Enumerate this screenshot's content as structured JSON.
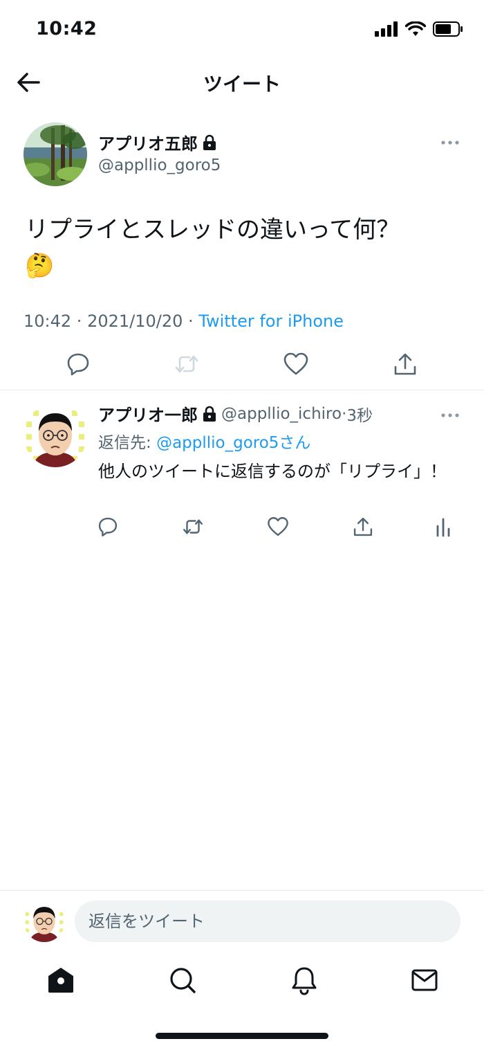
{
  "status_bar": {
    "time": "10:42"
  },
  "nav": {
    "title": "ツイート"
  },
  "main_tweet": {
    "author_name": "アプリオ五郎",
    "author_handle": "@appllio_goro5",
    "text": "リプライとスレッドの違いって何？",
    "emoji": "🤔",
    "time": "10:42",
    "date": "2021/10/20",
    "separator": " · ",
    "source": "Twitter for iPhone"
  },
  "reply": {
    "author_name": "アプリオ一郎",
    "author_handle": "@appllio_ichiro",
    "time_sep": " · ",
    "time_ago": "3秒",
    "reply_to_prefix": "返信先: ",
    "reply_to_mention": "@appllio_goro5さん",
    "text": "他人のツイートに返信するのが「リプライ」！"
  },
  "compose": {
    "placeholder": "返信をツイート"
  },
  "colors": {
    "accent": "#1d9bf0",
    "muted": "#536471",
    "text": "#0f1419"
  },
  "icons": [
    "back-arrow-icon",
    "lock-icon",
    "more-icon",
    "reply-icon",
    "retweet-icon",
    "like-icon",
    "share-icon",
    "analytics-icon",
    "home-icon",
    "search-icon",
    "notifications-icon",
    "messages-icon"
  ]
}
